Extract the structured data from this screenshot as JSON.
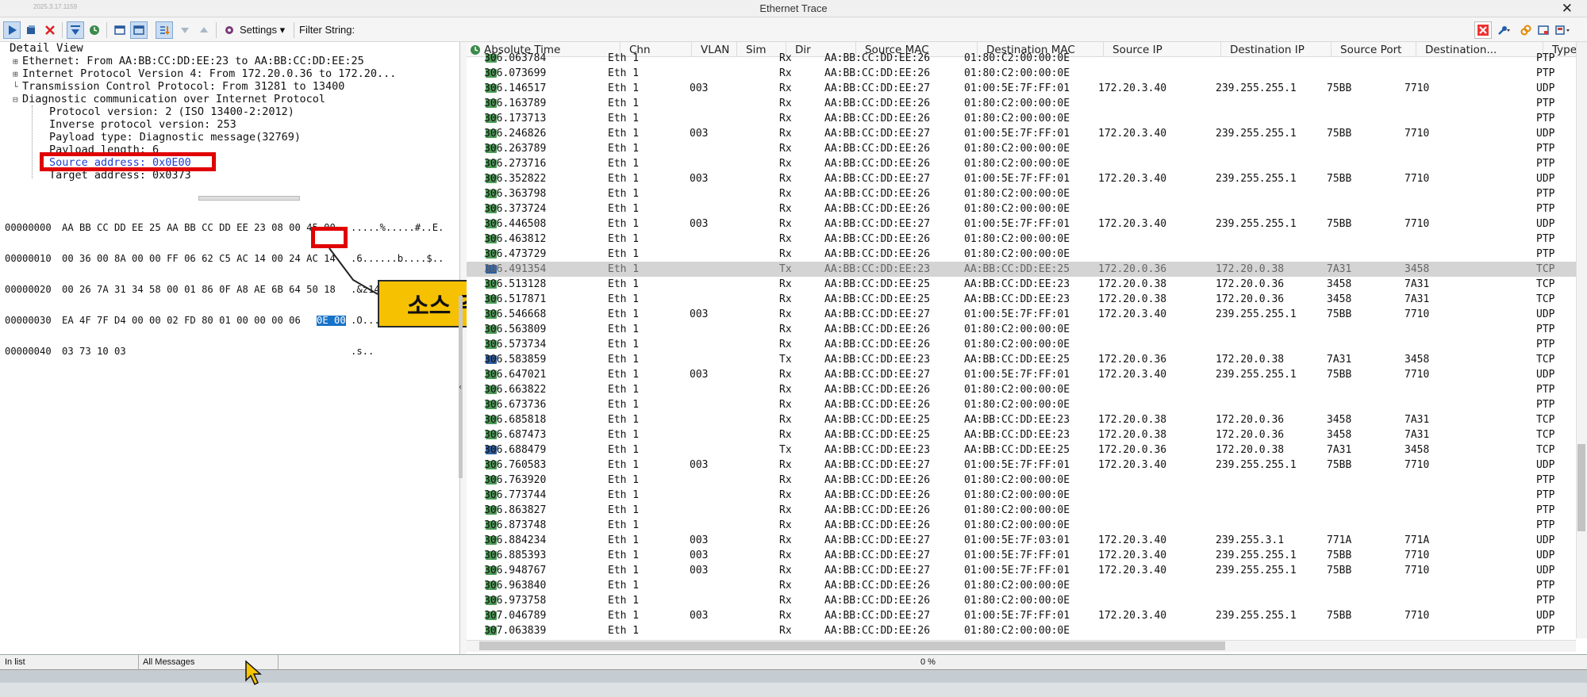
{
  "window": {
    "title": "Ethernet Trace",
    "version": "2025.3.17.1159",
    "close_glyph": "✕"
  },
  "toolbar": {
    "settings_label": "Settings",
    "filter_label": "Filter String:",
    "icons": [
      "play-icon",
      "stop-icon",
      "delete-icon",
      "scroll-icon",
      "clock-icon",
      "window-icon",
      "window-pressed-icon",
      "sort-icon",
      "arrow-down-icon",
      "arrow-up-icon",
      "gear-icon",
      "clear-filter-icon",
      "wrench-icon",
      "link-icon",
      "window-min-icon",
      "dock-icon"
    ]
  },
  "detail": {
    "header": "Detail View",
    "lines": [
      "Ethernet: From AA:BB:CC:DD:EE:23 to AA:BB:CC:DD:EE:25",
      "Internet Protocol Version 4: From 172.20.0.36 to 172.20...",
      "Transmission Control Protocol: From 31281 to 13400",
      "Diagnostic communication over Internet Protocol"
    ],
    "children": [
      "Protocol version: 2 (ISO 13400-2:2012)",
      "Inverse protocol version: 253",
      "Payload type: Diagnostic message(32769)",
      "Payload length: 6",
      "Source address: 0x0E00",
      "Target address: 0x0373"
    ]
  },
  "hex": {
    "rows": [
      {
        "offset": "00000000",
        "bytes": "AA BB CC DD EE 25 AA BB CC DD EE 23 08 00 45 00",
        "ascii": ".....%.....#..E."
      },
      {
        "offset": "00000010",
        "bytes": "00 36 00 8A 00 00 FF 06 62 C5 AC 14 00 24 AC 14",
        "ascii": ".6......b....$.."
      },
      {
        "offset": "00000020",
        "bytes": "00 26 7A 31 34 58 00 01 86 0F A8 AE 6B 64 50 18",
        "ascii": ".&z14X......kdP."
      },
      {
        "offset": "00000030",
        "bytes": "EA 4F 7F D4 00 00 02 FD 80 01 00 00 00 06",
        "sel": "0E 00",
        "ascii": ".O............"
      },
      {
        "offset": "00000040",
        "bytes": "03 73 10 03",
        "ascii": ".s.."
      }
    ]
  },
  "callout": {
    "text": "소스 주소"
  },
  "columns": [
    "Absolute Time",
    "Chn",
    "VLAN",
    "Sim",
    "Dir",
    "Source MAC",
    "Destination MAC",
    "Source IP",
    "Destination IP",
    "Source Port",
    "Destination...",
    "Type"
  ],
  "rows": [
    {
      "t": "306.063784",
      "chn": "Eth 1",
      "vlan": "",
      "dir": "Rx",
      "smac": "AA:BB:CC:DD:EE:26",
      "dmac": "01:80:C2:00:00:0E",
      "sip": "",
      "dip": "",
      "sport": "",
      "dport": "",
      "type": "PTP"
    },
    {
      "t": "306.073699",
      "chn": "Eth 1",
      "vlan": "",
      "dir": "Rx",
      "smac": "AA:BB:CC:DD:EE:26",
      "dmac": "01:80:C2:00:00:0E",
      "sip": "",
      "dip": "",
      "sport": "",
      "dport": "",
      "type": "PTP"
    },
    {
      "t": "306.146517",
      "chn": "Eth 1",
      "vlan": "003",
      "dir": "Rx",
      "smac": "AA:BB:CC:DD:EE:27",
      "dmac": "01:00:5E:7F:FF:01",
      "sip": "172.20.3.40",
      "dip": "239.255.255.1",
      "sport": "75BB",
      "dport": "7710",
      "type": "UDP"
    },
    {
      "t": "306.163789",
      "chn": "Eth 1",
      "vlan": "",
      "dir": "Rx",
      "smac": "AA:BB:CC:DD:EE:26",
      "dmac": "01:80:C2:00:00:0E",
      "sip": "",
      "dip": "",
      "sport": "",
      "dport": "",
      "type": "PTP"
    },
    {
      "t": "306.173713",
      "chn": "Eth 1",
      "vlan": "",
      "dir": "Rx",
      "smac": "AA:BB:CC:DD:EE:26",
      "dmac": "01:80:C2:00:00:0E",
      "sip": "",
      "dip": "",
      "sport": "",
      "dport": "",
      "type": "PTP"
    },
    {
      "t": "306.246826",
      "chn": "Eth 1",
      "vlan": "003",
      "dir": "Rx",
      "smac": "AA:BB:CC:DD:EE:27",
      "dmac": "01:00:5E:7F:FF:01",
      "sip": "172.20.3.40",
      "dip": "239.255.255.1",
      "sport": "75BB",
      "dport": "7710",
      "type": "UDP"
    },
    {
      "t": "306.263789",
      "chn": "Eth 1",
      "vlan": "",
      "dir": "Rx",
      "smac": "AA:BB:CC:DD:EE:26",
      "dmac": "01:80:C2:00:00:0E",
      "sip": "",
      "dip": "",
      "sport": "",
      "dport": "",
      "type": "PTP"
    },
    {
      "t": "306.273716",
      "chn": "Eth 1",
      "vlan": "",
      "dir": "Rx",
      "smac": "AA:BB:CC:DD:EE:26",
      "dmac": "01:80:C2:00:00:0E",
      "sip": "",
      "dip": "",
      "sport": "",
      "dport": "",
      "type": "PTP"
    },
    {
      "t": "306.352822",
      "chn": "Eth 1",
      "vlan": "003",
      "dir": "Rx",
      "smac": "AA:BB:CC:DD:EE:27",
      "dmac": "01:00:5E:7F:FF:01",
      "sip": "172.20.3.40",
      "dip": "239.255.255.1",
      "sport": "75BB",
      "dport": "7710",
      "type": "UDP"
    },
    {
      "t": "306.363798",
      "chn": "Eth 1",
      "vlan": "",
      "dir": "Rx",
      "smac": "AA:BB:CC:DD:EE:26",
      "dmac": "01:80:C2:00:00:0E",
      "sip": "",
      "dip": "",
      "sport": "",
      "dport": "",
      "type": "PTP"
    },
    {
      "t": "306.373724",
      "chn": "Eth 1",
      "vlan": "",
      "dir": "Rx",
      "smac": "AA:BB:CC:DD:EE:26",
      "dmac": "01:80:C2:00:00:0E",
      "sip": "",
      "dip": "",
      "sport": "",
      "dport": "",
      "type": "PTP"
    },
    {
      "t": "306.446508",
      "chn": "Eth 1",
      "vlan": "003",
      "dir": "Rx",
      "smac": "AA:BB:CC:DD:EE:27",
      "dmac": "01:00:5E:7F:FF:01",
      "sip": "172.20.3.40",
      "dip": "239.255.255.1",
      "sport": "75BB",
      "dport": "7710",
      "type": "UDP"
    },
    {
      "t": "306.463812",
      "chn": "Eth 1",
      "vlan": "",
      "dir": "Rx",
      "smac": "AA:BB:CC:DD:EE:26",
      "dmac": "01:80:C2:00:00:0E",
      "sip": "",
      "dip": "",
      "sport": "",
      "dport": "",
      "type": "PTP"
    },
    {
      "t": "306.473729",
      "chn": "Eth 1",
      "vlan": "",
      "dir": "Rx",
      "smac": "AA:BB:CC:DD:EE:26",
      "dmac": "01:80:C2:00:00:0E",
      "sip": "",
      "dip": "",
      "sport": "",
      "dport": "",
      "type": "PTP"
    },
    {
      "t": "306.491354",
      "chn": "Eth 1",
      "vlan": "",
      "dir": "Tx",
      "smac": "AA:BB:CC:DD:EE:23",
      "dmac": "AA:BB:CC:DD:EE:25",
      "sip": "172.20.0.36",
      "dip": "172.20.0.38",
      "sport": "7A31",
      "dport": "3458",
      "type": "TCP",
      "selected": true
    },
    {
      "t": "306.513128",
      "chn": "Eth 1",
      "vlan": "",
      "dir": "Rx",
      "smac": "AA:BB:CC:DD:EE:25",
      "dmac": "AA:BB:CC:DD:EE:23",
      "sip": "172.20.0.38",
      "dip": "172.20.0.36",
      "sport": "3458",
      "dport": "7A31",
      "type": "TCP"
    },
    {
      "t": "306.517871",
      "chn": "Eth 1",
      "vlan": "",
      "dir": "Rx",
      "smac": "AA:BB:CC:DD:EE:25",
      "dmac": "AA:BB:CC:DD:EE:23",
      "sip": "172.20.0.38",
      "dip": "172.20.0.36",
      "sport": "3458",
      "dport": "7A31",
      "type": "TCP"
    },
    {
      "t": "306.546668",
      "chn": "Eth 1",
      "vlan": "003",
      "dir": "Rx",
      "smac": "AA:BB:CC:DD:EE:27",
      "dmac": "01:00:5E:7F:FF:01",
      "sip": "172.20.3.40",
      "dip": "239.255.255.1",
      "sport": "75BB",
      "dport": "7710",
      "type": "UDP"
    },
    {
      "t": "306.563809",
      "chn": "Eth 1",
      "vlan": "",
      "dir": "Rx",
      "smac": "AA:BB:CC:DD:EE:26",
      "dmac": "01:80:C2:00:00:0E",
      "sip": "",
      "dip": "",
      "sport": "",
      "dport": "",
      "type": "PTP"
    },
    {
      "t": "306.573734",
      "chn": "Eth 1",
      "vlan": "",
      "dir": "Rx",
      "smac": "AA:BB:CC:DD:EE:26",
      "dmac": "01:80:C2:00:00:0E",
      "sip": "",
      "dip": "",
      "sport": "",
      "dport": "",
      "type": "PTP"
    },
    {
      "t": "306.583859",
      "chn": "Eth 1",
      "vlan": "",
      "dir": "Tx",
      "smac": "AA:BB:CC:DD:EE:23",
      "dmac": "AA:BB:CC:DD:EE:25",
      "sip": "172.20.0.36",
      "dip": "172.20.0.38",
      "sport": "7A31",
      "dport": "3458",
      "type": "TCP"
    },
    {
      "t": "306.647021",
      "chn": "Eth 1",
      "vlan": "003",
      "dir": "Rx",
      "smac": "AA:BB:CC:DD:EE:27",
      "dmac": "01:00:5E:7F:FF:01",
      "sip": "172.20.3.40",
      "dip": "239.255.255.1",
      "sport": "75BB",
      "dport": "7710",
      "type": "UDP"
    },
    {
      "t": "306.663822",
      "chn": "Eth 1",
      "vlan": "",
      "dir": "Rx",
      "smac": "AA:BB:CC:DD:EE:26",
      "dmac": "01:80:C2:00:00:0E",
      "sip": "",
      "dip": "",
      "sport": "",
      "dport": "",
      "type": "PTP"
    },
    {
      "t": "306.673736",
      "chn": "Eth 1",
      "vlan": "",
      "dir": "Rx",
      "smac": "AA:BB:CC:DD:EE:26",
      "dmac": "01:80:C2:00:00:0E",
      "sip": "",
      "dip": "",
      "sport": "",
      "dport": "",
      "type": "PTP"
    },
    {
      "t": "306.685818",
      "chn": "Eth 1",
      "vlan": "",
      "dir": "Rx",
      "smac": "AA:BB:CC:DD:EE:25",
      "dmac": "AA:BB:CC:DD:EE:23",
      "sip": "172.20.0.38",
      "dip": "172.20.0.36",
      "sport": "3458",
      "dport": "7A31",
      "type": "TCP"
    },
    {
      "t": "306.687473",
      "chn": "Eth 1",
      "vlan": "",
      "dir": "Rx",
      "smac": "AA:BB:CC:DD:EE:25",
      "dmac": "AA:BB:CC:DD:EE:23",
      "sip": "172.20.0.38",
      "dip": "172.20.0.36",
      "sport": "3458",
      "dport": "7A31",
      "type": "TCP"
    },
    {
      "t": "306.688479",
      "chn": "Eth 1",
      "vlan": "",
      "dir": "Tx",
      "smac": "AA:BB:CC:DD:EE:23",
      "dmac": "AA:BB:CC:DD:EE:25",
      "sip": "172.20.0.36",
      "dip": "172.20.0.38",
      "sport": "7A31",
      "dport": "3458",
      "type": "TCP"
    },
    {
      "t": "306.760583",
      "chn": "Eth 1",
      "vlan": "003",
      "dir": "Rx",
      "smac": "AA:BB:CC:DD:EE:27",
      "dmac": "01:00:5E:7F:FF:01",
      "sip": "172.20.3.40",
      "dip": "239.255.255.1",
      "sport": "75BB",
      "dport": "7710",
      "type": "UDP"
    },
    {
      "t": "306.763920",
      "chn": "Eth 1",
      "vlan": "",
      "dir": "Rx",
      "smac": "AA:BB:CC:DD:EE:26",
      "dmac": "01:80:C2:00:00:0E",
      "sip": "",
      "dip": "",
      "sport": "",
      "dport": "",
      "type": "PTP"
    },
    {
      "t": "306.773744",
      "chn": "Eth 1",
      "vlan": "",
      "dir": "Rx",
      "smac": "AA:BB:CC:DD:EE:26",
      "dmac": "01:80:C2:00:00:0E",
      "sip": "",
      "dip": "",
      "sport": "",
      "dport": "",
      "type": "PTP"
    },
    {
      "t": "306.863827",
      "chn": "Eth 1",
      "vlan": "",
      "dir": "Rx",
      "smac": "AA:BB:CC:DD:EE:26",
      "dmac": "01:80:C2:00:00:0E",
      "sip": "",
      "dip": "",
      "sport": "",
      "dport": "",
      "type": "PTP"
    },
    {
      "t": "306.873748",
      "chn": "Eth 1",
      "vlan": "",
      "dir": "Rx",
      "smac": "AA:BB:CC:DD:EE:26",
      "dmac": "01:80:C2:00:00:0E",
      "sip": "",
      "dip": "",
      "sport": "",
      "dport": "",
      "type": "PTP"
    },
    {
      "t": "306.884234",
      "chn": "Eth 1",
      "vlan": "003",
      "dir": "Rx",
      "smac": "AA:BB:CC:DD:EE:27",
      "dmac": "01:00:5E:7F:03:01",
      "sip": "172.20.3.40",
      "dip": "239.255.3.1",
      "sport": "771A",
      "dport": "771A",
      "type": "UDP"
    },
    {
      "t": "306.885393",
      "chn": "Eth 1",
      "vlan": "003",
      "dir": "Rx",
      "smac": "AA:BB:CC:DD:EE:27",
      "dmac": "01:00:5E:7F:FF:01",
      "sip": "172.20.3.40",
      "dip": "239.255.255.1",
      "sport": "75BB",
      "dport": "7710",
      "type": "UDP"
    },
    {
      "t": "306.948767",
      "chn": "Eth 1",
      "vlan": "003",
      "dir": "Rx",
      "smac": "AA:BB:CC:DD:EE:27",
      "dmac": "01:00:5E:7F:FF:01",
      "sip": "172.20.3.40",
      "dip": "239.255.255.1",
      "sport": "75BB",
      "dport": "7710",
      "type": "UDP"
    },
    {
      "t": "306.963840",
      "chn": "Eth 1",
      "vlan": "",
      "dir": "Rx",
      "smac": "AA:BB:CC:DD:EE:26",
      "dmac": "01:80:C2:00:00:0E",
      "sip": "",
      "dip": "",
      "sport": "",
      "dport": "",
      "type": "PTP"
    },
    {
      "t": "306.973758",
      "chn": "Eth 1",
      "vlan": "",
      "dir": "Rx",
      "smac": "AA:BB:CC:DD:EE:26",
      "dmac": "01:80:C2:00:00:0E",
      "sip": "",
      "dip": "",
      "sport": "",
      "dport": "",
      "type": "PTP"
    },
    {
      "t": "307.046789",
      "chn": "Eth 1",
      "vlan": "003",
      "dir": "Rx",
      "smac": "AA:BB:CC:DD:EE:27",
      "dmac": "01:00:5E:7F:FF:01",
      "sip": "172.20.3.40",
      "dip": "239.255.255.1",
      "sport": "75BB",
      "dport": "7710",
      "type": "UDP"
    },
    {
      "t": "307.063839",
      "chn": "Eth 1",
      "vlan": "",
      "dir": "Rx",
      "smac": "AA:BB:CC:DD:EE:26",
      "dmac": "01:80:C2:00:00:0E",
      "sip": "",
      "dip": "",
      "sport": "",
      "dport": "",
      "type": "PTP"
    }
  ],
  "status": {
    "left": "In list",
    "filter": "All Messages",
    "progress": "0 %"
  },
  "colors": {
    "highlight_box": "#e00000",
    "callout_bg": "#f6c100",
    "rx_icon": "#4d9a57",
    "tx_icon": "#2e5e9e",
    "hex_selection": "#1873c8"
  }
}
